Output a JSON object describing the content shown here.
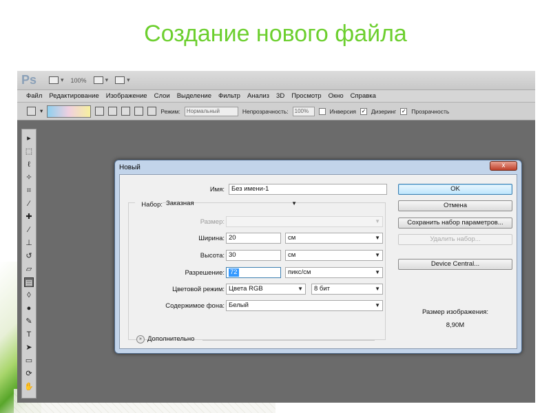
{
  "slide": {
    "title": "Создание нового файла"
  },
  "photoshop": {
    "logo": "Ps",
    "topbar": {
      "zoom": "100%"
    },
    "menu": [
      "Файл",
      "Редактирование",
      "Изображение",
      "Слои",
      "Выделение",
      "Фильтр",
      "Анализ",
      "3D",
      "Просмотр",
      "Окно",
      "Справка"
    ],
    "options": {
      "mode_label": "Режим:",
      "mode_value": "Нормальный",
      "opacity_label": "Непрозрачность:",
      "opacity_value": "100%",
      "check_inverse": "Инверсия",
      "check_dither": "Дизеринг",
      "check_transparency": "Прозрачность"
    }
  },
  "dialog": {
    "title": "Новый",
    "close_glyph": "x",
    "name": {
      "label": "Имя:",
      "value": "Без имени-1"
    },
    "preset": {
      "label": "Набор:",
      "value": "Заказная"
    },
    "size": {
      "label": "Размер:",
      "value": ""
    },
    "width": {
      "label": "Ширина:",
      "value": "20",
      "unit": "см"
    },
    "height": {
      "label": "Высота:",
      "value": "30",
      "unit": "см"
    },
    "resolution": {
      "label": "Разрешение:",
      "value": "72",
      "unit": "пикс/см"
    },
    "color_mode": {
      "label": "Цветовой режим:",
      "value": "Цвета RGB",
      "depth": "8 бит"
    },
    "background": {
      "label": "Содержимое фона:",
      "value": "Белый"
    },
    "advanced": {
      "label": "Дополнительно"
    },
    "buttons": {
      "ok": "OK",
      "cancel": "Отмена",
      "save_preset": "Сохранить набор параметров...",
      "delete_preset": "Удалить набор...",
      "device_central": "Device Central..."
    },
    "image_size": {
      "label": "Размер изображения:",
      "value": "8,90M"
    }
  }
}
